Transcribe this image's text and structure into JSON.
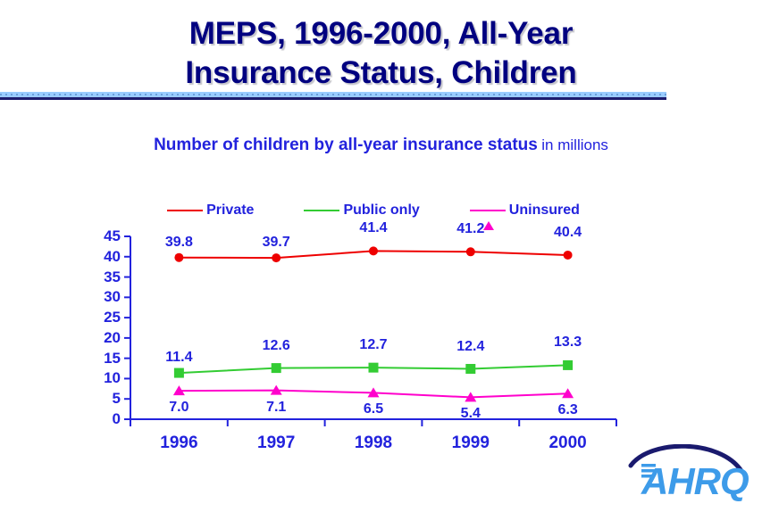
{
  "slide": {
    "title_line1": "MEPS, 1996-2000, All-Year",
    "title_line2": "Insurance Status, Children",
    "title_color": "#000080",
    "divider_color": "#1b1b6e",
    "divider_band_color": "#99ccff",
    "logo_name": "AHRQ",
    "logo_color": "#3d9be9",
    "logo_arc_color": "#1a1a6e"
  },
  "chart_data": {
    "type": "line",
    "title": "Number of children by all-year insurance status",
    "subtitle_suffix": "in millions",
    "xlabel": "",
    "ylabel": "",
    "categories": [
      "1996",
      "1997",
      "1998",
      "1999",
      "2000"
    ],
    "ylim": [
      0,
      45
    ],
    "yticks": [
      "45",
      "40",
      "35",
      "30",
      "25",
      "20",
      "15",
      "10",
      "5",
      "0"
    ],
    "grid": false,
    "legend_position": "top",
    "series": [
      {
        "name": "Private",
        "color": "#ee0000",
        "marker": "circle",
        "label_position": "above",
        "values": [
          39.8,
          39.7,
          41.4,
          41.2,
          40.4
        ],
        "labels": [
          "39.8",
          "39.7",
          "41.4",
          "41.2",
          "40.4"
        ]
      },
      {
        "name": "Public only",
        "color": "#33cc33",
        "marker": "square",
        "label_position": "above",
        "values": [
          11.4,
          12.6,
          12.7,
          12.4,
          13.3
        ],
        "labels": [
          "11.4",
          "12.6",
          "12.7",
          "12.4",
          "13.3"
        ]
      },
      {
        "name": "Uninsured",
        "color": "#ff00cc",
        "marker": "triangle",
        "label_position": "below",
        "values": [
          7.0,
          7.1,
          6.5,
          5.4,
          6.3
        ],
        "labels": [
          "7.0",
          "7.1",
          "6.5",
          "5.4",
          "6.3"
        ]
      }
    ],
    "axis_color": "#2222dd",
    "label_color": "#2222dd"
  }
}
